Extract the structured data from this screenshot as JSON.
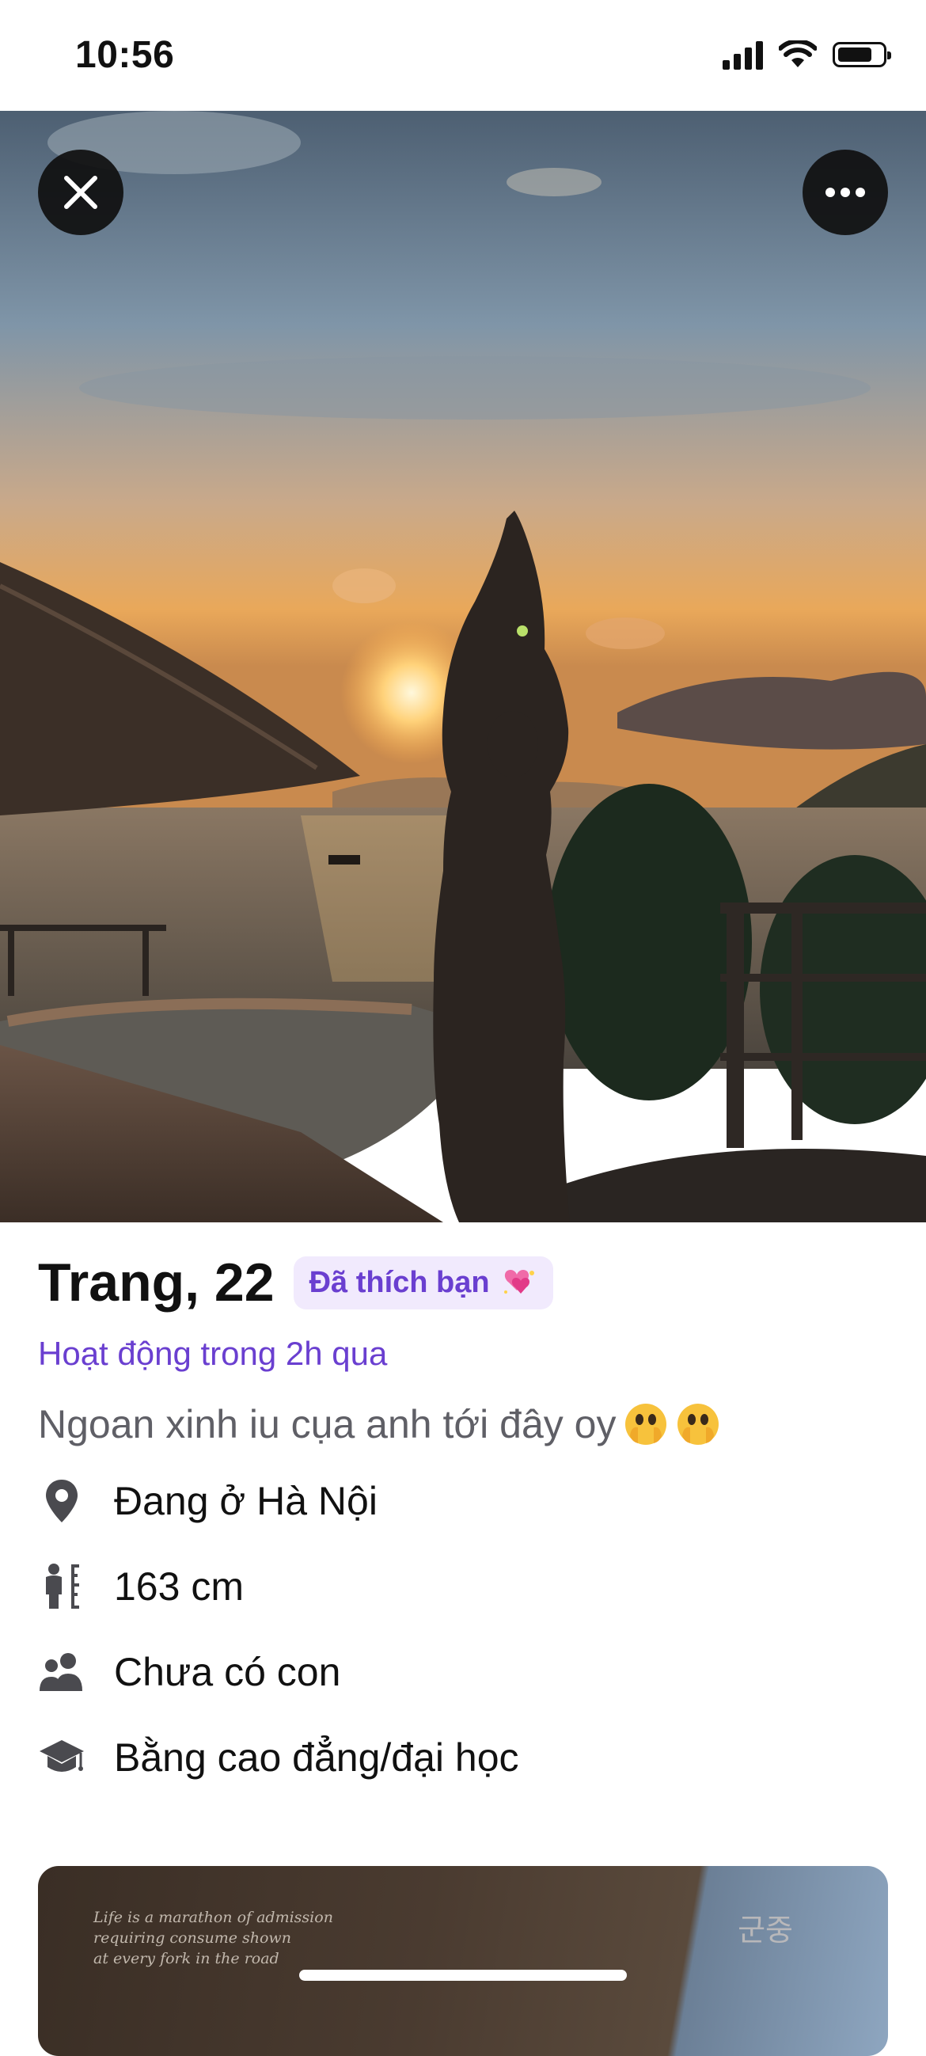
{
  "status_bar": {
    "time": "10:56"
  },
  "profile": {
    "name_age": "Trang, 22",
    "liked_badge": "Đã thích bạn",
    "activity": "Hoạt động trong 2h qua",
    "bio": "Ngoan xinh iu cụa anh tới đây oy",
    "info": [
      {
        "icon": "location-pin-icon",
        "text": "Đang ở Hà Nội"
      },
      {
        "icon": "height-icon",
        "text": "163 cm"
      },
      {
        "icon": "people-icon",
        "text": "Chưa có con"
      },
      {
        "icon": "graduation-cap-icon",
        "text": "Bằng cao đẳng/đại học"
      }
    ]
  },
  "next_card": {
    "quote_lines": [
      "Life is a marathon of admission",
      "requiring consume shown",
      "at every fork in the road"
    ],
    "korean_text": "군중"
  },
  "colors": {
    "accent": "#6a3fd0",
    "badge_bg": "#f1eafd",
    "muted_text": "#5f5f66"
  }
}
